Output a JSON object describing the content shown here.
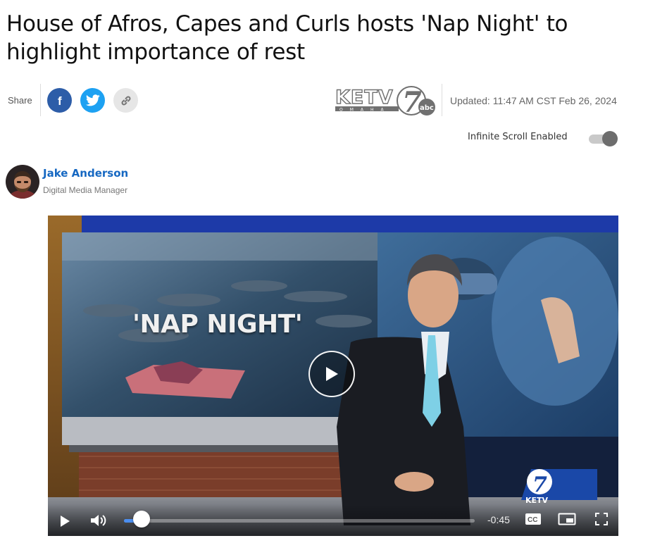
{
  "article": {
    "headline": "House of Afros, Capes and Curls hosts 'Nap Night' to highlight importance of rest",
    "updated": "Updated: 11:47 AM CST Feb 26, 2024"
  },
  "share": {
    "label": "Share",
    "buttons": [
      {
        "name": "facebook",
        "icon": "facebook-icon",
        "color": "#2d5da8"
      },
      {
        "name": "twitter",
        "icon": "twitter-icon",
        "color": "#1da1f2"
      },
      {
        "name": "copy-link",
        "icon": "link-icon",
        "color": "#e6e6e6"
      }
    ]
  },
  "brand": {
    "logo_text": "KETV",
    "logo_subtext": "OMAHA",
    "channel_number": "7",
    "network": "abc"
  },
  "infinite_scroll": {
    "label": "Infinite Scroll Enabled",
    "enabled": true
  },
  "author": {
    "name": "Jake Anderson",
    "title": "Digital Media Manager"
  },
  "video": {
    "overlay_text": "'NAP NIGHT'",
    "bug_number": "7",
    "bug_text": "KETV",
    "time_remaining": "-0:45",
    "progress_fraction": 0.05,
    "cc_label": "CC",
    "accent_color": "#4b8ef0"
  }
}
